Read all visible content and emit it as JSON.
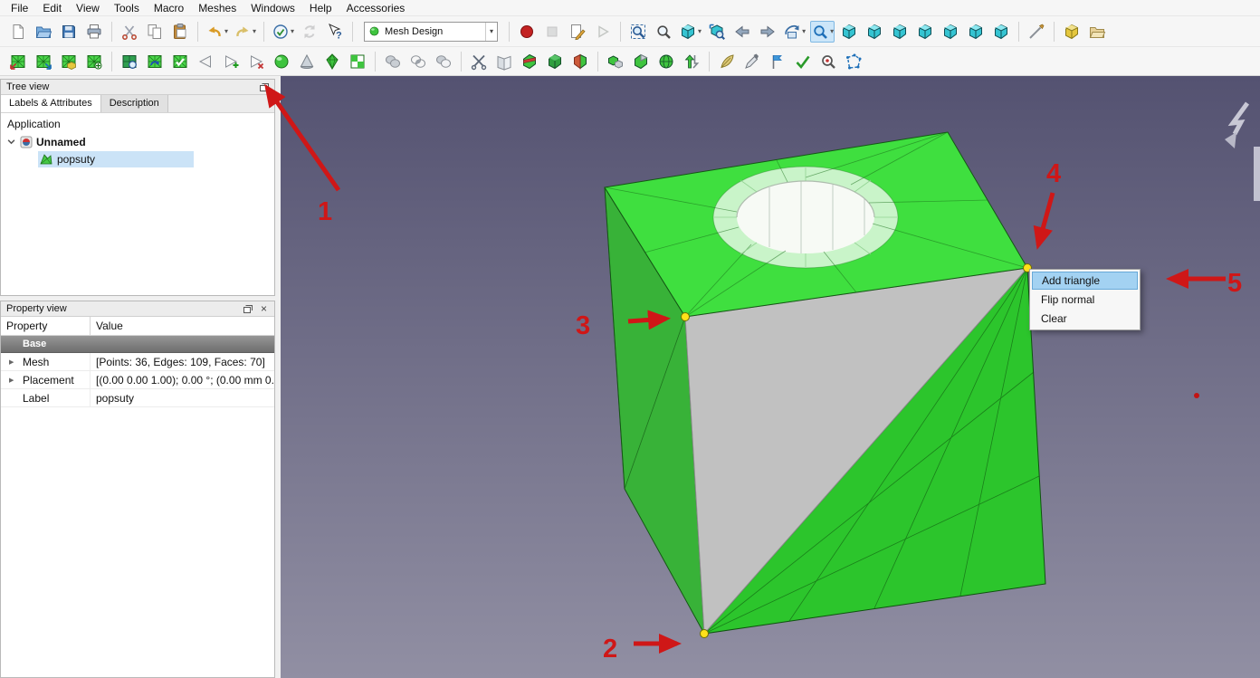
{
  "colors": {
    "accent": "#0078d7",
    "selection": "#cbe3f7",
    "annotation_red": "#cf1717",
    "viewport_gradient_top": "#545271",
    "viewport_gradient_bottom": "#918fa3",
    "mesh_green_top": "#3fdf3f",
    "mesh_green_left": "#38b238",
    "mesh_green_right": "#2cc52c",
    "mesh_missing_gray": "#c1c1c1",
    "vertex_yellow": "#ffe11a"
  },
  "menubar": {
    "items": [
      "File",
      "Edit",
      "View",
      "Tools",
      "Macro",
      "Meshes",
      "Windows",
      "Help",
      "Accessories"
    ]
  },
  "toolbar_main": {
    "items": [
      {
        "type": "button",
        "name": "std-new",
        "icon": "page"
      },
      {
        "type": "button",
        "name": "std-open",
        "icon": "folder"
      },
      {
        "type": "button",
        "name": "std-save",
        "icon": "save"
      },
      {
        "type": "button",
        "name": "std-print",
        "icon": "printer"
      },
      {
        "type": "separator"
      },
      {
        "type": "button",
        "name": "std-cut",
        "icon": "scissors"
      },
      {
        "type": "button",
        "name": "std-copy",
        "icon": "copy"
      },
      {
        "type": "button",
        "name": "std-paste",
        "icon": "paste"
      },
      {
        "type": "separator"
      },
      {
        "type": "button",
        "name": "std-undo",
        "icon": "undo",
        "dropdown": true
      },
      {
        "type": "button",
        "name": "std-redo",
        "icon": "redo",
        "dropdown": true
      },
      {
        "type": "separator"
      },
      {
        "type": "button",
        "name": "std-edit-mode",
        "icon": "edit-badge",
        "dropdown": true
      },
      {
        "type": "button",
        "name": "std-refresh",
        "icon": "refresh",
        "disabled": true
      },
      {
        "type": "button",
        "name": "std-whats-this",
        "icon": "help-cursor"
      },
      {
        "type": "separator"
      },
      {
        "type": "combo",
        "name": "workbench-selector",
        "icon": "wb-sphere",
        "label": "Mesh Design"
      },
      {
        "type": "separator"
      },
      {
        "type": "button",
        "name": "macro-record",
        "icon": "record"
      },
      {
        "type": "button",
        "name": "macro-stop",
        "icon": "stop",
        "disabled": true
      },
      {
        "type": "button",
        "name": "macro-edit",
        "icon": "macro-edit"
      },
      {
        "type": "button",
        "name": "macro-debug",
        "icon": "play",
        "disabled": true
      },
      {
        "type": "separator"
      },
      {
        "type": "button",
        "name": "view-fit-all",
        "icon": "zoom-fit"
      },
      {
        "type": "button",
        "name": "view-fit-selection",
        "icon": "zoom"
      },
      {
        "type": "button",
        "name": "view-draw-style",
        "icon": "view-cube",
        "dropdown": true
      },
      {
        "type": "button",
        "name": "view-zoom-box",
        "icon": "zoom-box"
      },
      {
        "type": "button",
        "name": "nav-back",
        "icon": "arrow-left"
      },
      {
        "type": "button",
        "name": "nav-forward",
        "icon": "arrow-right"
      },
      {
        "type": "button",
        "name": "view-navigation",
        "icon": "nav-orbit",
        "dropdown": true
      },
      {
        "type": "button",
        "name": "view-zoom-tool",
        "icon": "zoom-blue",
        "dropdown": true,
        "active": true
      },
      {
        "type": "button",
        "name": "view-axonometric",
        "icon": "view-cube"
      },
      {
        "type": "button",
        "name": "view-front",
        "icon": "view-cube"
      },
      {
        "type": "button",
        "name": "view-top",
        "icon": "view-cube"
      },
      {
        "type": "button",
        "name": "view-right",
        "icon": "view-cube"
      },
      {
        "type": "button",
        "name": "view-rear",
        "icon": "view-cube"
      },
      {
        "type": "button",
        "name": "view-bottom",
        "icon": "view-cube"
      },
      {
        "type": "button",
        "name": "view-left",
        "icon": "view-cube"
      },
      {
        "type": "separator"
      },
      {
        "type": "button",
        "name": "measure-distance",
        "icon": "measure"
      },
      {
        "type": "separator"
      },
      {
        "type": "button",
        "name": "create-part",
        "icon": "part-box"
      },
      {
        "type": "button",
        "name": "create-group",
        "icon": "group-folder"
      }
    ]
  },
  "toolbar_mesh": {
    "items": [
      {
        "type": "button",
        "name": "mesh-import",
        "icon": "mesh-import"
      },
      {
        "type": "button",
        "name": "mesh-export",
        "icon": "mesh-export"
      },
      {
        "type": "button",
        "name": "mesh-from-shape",
        "icon": "mesh-shape"
      },
      {
        "type": "button",
        "name": "mesh-refine",
        "icon": "mesh-refine"
      },
      {
        "type": "separator"
      },
      {
        "type": "button",
        "name": "mesh-curvature-analyze",
        "icon": "mesh-analyze"
      },
      {
        "type": "button",
        "name": "mesh-harmonize-normals",
        "icon": "mesh-harmonize"
      },
      {
        "type": "button",
        "name": "mesh-evaluate-repair",
        "icon": "mesh-evaluate"
      },
      {
        "type": "button",
        "name": "mesh-flip-normals",
        "icon": "tri-outline"
      },
      {
        "type": "button",
        "name": "mesh-add-triangle",
        "icon": "tri-plus"
      },
      {
        "type": "button",
        "name": "mesh-remove-components",
        "icon": "tri-x"
      },
      {
        "type": "button",
        "name": "mesh-smooth",
        "icon": "sphere"
      },
      {
        "type": "button",
        "name": "mesh-decimate",
        "icon": "cone"
      },
      {
        "type": "button",
        "name": "mesh-regular-solid",
        "icon": "diamond"
      },
      {
        "type": "button",
        "name": "mesh-boundary",
        "icon": "checker"
      },
      {
        "type": "separator"
      },
      {
        "type": "button",
        "name": "mesh-boolean-union",
        "icon": "bool-union"
      },
      {
        "type": "button",
        "name": "mesh-boolean-intersection",
        "icon": "bool-intersect"
      },
      {
        "type": "button",
        "name": "mesh-boolean-difference",
        "icon": "bool-diff"
      },
      {
        "type": "separator"
      },
      {
        "type": "button",
        "name": "mesh-cut",
        "icon": "cut-tool"
      },
      {
        "type": "button",
        "name": "mesh-trim",
        "icon": "trim-tool"
      },
      {
        "type": "button",
        "name": "mesh-trim-by-plane",
        "icon": "cube-band"
      },
      {
        "type": "button",
        "name": "mesh-section",
        "icon": "cube-dark"
      },
      {
        "type": "button",
        "name": "mesh-cross-sections",
        "icon": "cube-split"
      },
      {
        "type": "separator"
      },
      {
        "type": "button",
        "name": "mesh-merge",
        "icon": "cube-merge"
      },
      {
        "type": "button",
        "name": "mesh-split",
        "icon": "cube-corner"
      },
      {
        "type": "button",
        "name": "mesh-scale",
        "icon": "globe"
      },
      {
        "type": "button",
        "name": "mesh-unwrap",
        "icon": "scale-arrows"
      },
      {
        "type": "separator"
      },
      {
        "type": "button",
        "name": "mesh-smooth-region",
        "icon": "feather"
      },
      {
        "type": "button",
        "name": "mesh-vertex-color",
        "icon": "eyedropper"
      },
      {
        "type": "button",
        "name": "mesh-annotation",
        "icon": "flag"
      },
      {
        "type": "button",
        "name": "mesh-validate",
        "icon": "check-tool"
      },
      {
        "type": "button",
        "name": "mesh-inspect",
        "icon": "inspect"
      },
      {
        "type": "button",
        "name": "mesh-polygon-cut",
        "icon": "poly-select"
      }
    ]
  },
  "panels": {
    "tree": {
      "title": "Tree view",
      "tabs": [
        {
          "label": "Labels & Attributes",
          "active": true
        },
        {
          "label": "Description",
          "active": false
        }
      ],
      "root_label": "Application",
      "document": {
        "label": "Unnamed"
      },
      "item": {
        "label": "popsuty",
        "selected": true
      }
    },
    "properties": {
      "title": "Property view",
      "columns": [
        "Property",
        "Value"
      ],
      "group": "Base",
      "rows": [
        {
          "property": "Mesh",
          "value": "[Points: 36, Edges: 109, Faces: 70]",
          "expandable": true
        },
        {
          "property": "Placement",
          "value": "[(0.00 0.00 1.00); 0.00 °; (0.00 mm 0...",
          "expandable": true
        },
        {
          "property": "Label",
          "value": "popsuty",
          "expandable": false
        }
      ]
    }
  },
  "context_menu": {
    "items": [
      {
        "label": "Add triangle",
        "highlighted": true
      },
      {
        "label": "Flip normal",
        "highlighted": false
      },
      {
        "label": "Clear",
        "highlighted": false
      }
    ]
  },
  "annotations": {
    "labels": [
      "1",
      "2",
      "3",
      "4",
      "5"
    ]
  }
}
